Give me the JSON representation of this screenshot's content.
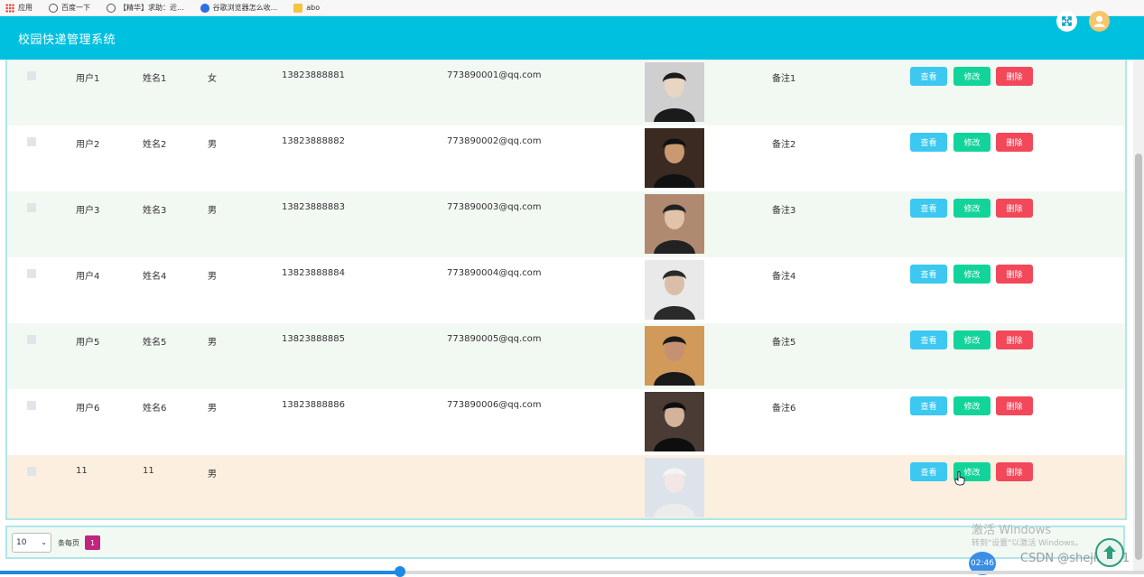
{
  "bookmarks": [
    {
      "icon": "apps-icon",
      "label": "应用"
    },
    {
      "icon": "globe-icon",
      "label": "百度一下"
    },
    {
      "icon": "globe-icon",
      "label": "【精华】求助：近..."
    },
    {
      "icon": "paw-icon",
      "label": "谷歌浏览器怎么收..."
    },
    {
      "icon": "folder-icon",
      "label": "abo"
    }
  ],
  "header": {
    "title": "校园快递管理系统",
    "accent": "#00c0e0",
    "fullscreen_icon": "fullscreen-icon",
    "avatar_icon": "user-avatar-icon"
  },
  "actions": {
    "view": "查看",
    "edit": "修改",
    "delete": "删除"
  },
  "rows": [
    {
      "user": "用户1",
      "name": "姓名1",
      "sex": "女",
      "phone": "13823888881",
      "email": "773890001@qq.com",
      "note": "备注1"
    },
    {
      "user": "用户2",
      "name": "姓名2",
      "sex": "男",
      "phone": "13823888882",
      "email": "773890002@qq.com",
      "note": "备注2"
    },
    {
      "user": "用户3",
      "name": "姓名3",
      "sex": "男",
      "phone": "13823888883",
      "email": "773890003@qq.com",
      "note": "备注3"
    },
    {
      "user": "用户4",
      "name": "姓名4",
      "sex": "男",
      "phone": "13823888884",
      "email": "773890004@qq.com",
      "note": "备注4"
    },
    {
      "user": "用户5",
      "name": "姓名5",
      "sex": "男",
      "phone": "13823888885",
      "email": "773890005@qq.com",
      "note": "备注5"
    },
    {
      "user": "用户6",
      "name": "姓名6",
      "sex": "男",
      "phone": "13823888886",
      "email": "773890006@qq.com",
      "note": "备注6"
    },
    {
      "user": "11",
      "name": "11",
      "sex": "男",
      "phone": "",
      "email": "",
      "note": ""
    }
  ],
  "pager": {
    "page_size": "10",
    "per_page_label": "条每页",
    "current_page": "1"
  },
  "overlay": {
    "watermark_title": "激活 Windows",
    "watermark_sub": "转到\"设置\"以激活 Windows。",
    "csdn": "CSDN @shejii1011",
    "time": "02:46"
  },
  "progress_fraction": 0.35
}
